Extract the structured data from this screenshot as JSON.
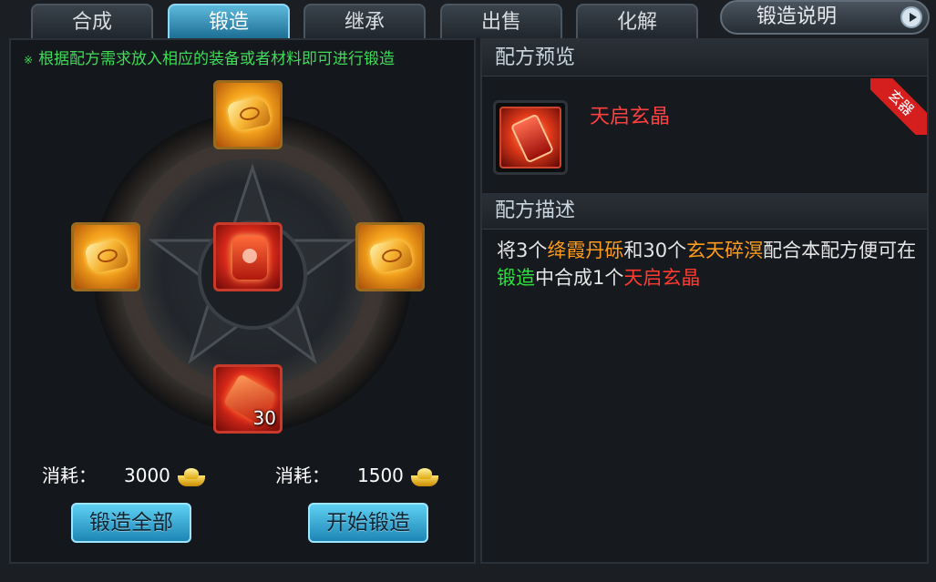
{
  "tabs": [
    {
      "label": "合成",
      "active": false
    },
    {
      "label": "锻造",
      "active": true
    },
    {
      "label": "继承",
      "active": false
    },
    {
      "label": "出售",
      "active": false
    },
    {
      "label": "化解",
      "active": false
    }
  ],
  "help_button": {
    "label": "锻造说明"
  },
  "forge": {
    "hint": "根据配方需求放入相应的装备或者材料即可进行锻造",
    "hint_mark": "※",
    "bottom_item_count": "30",
    "cost_all": {
      "label": "消耗：",
      "value": "3000"
    },
    "cost_single": {
      "label": "消耗：",
      "value": "1500"
    },
    "forge_all_button": "锻造全部",
    "start_forge_button": "开始锻造"
  },
  "preview": {
    "title": "配方预览",
    "item_name": "天启玄晶",
    "badge": "玄器"
  },
  "description": {
    "title": "配方描述",
    "parts": [
      {
        "text": "将3个",
        "color": "white"
      },
      {
        "text": "绛霞丹砾",
        "color": "orange"
      },
      {
        "text": "和30个",
        "color": "white"
      },
      {
        "text": "玄天碎溟",
        "color": "orange"
      },
      {
        "text": "配合本配方便可在",
        "color": "white"
      },
      {
        "text": "锻造",
        "color": "green"
      },
      {
        "text": "中合成1个",
        "color": "white"
      },
      {
        "text": "天启玄晶",
        "color": "red"
      }
    ]
  },
  "colors": {
    "accent": "#5db9dc",
    "hint_green": "#3fdc5a",
    "item_red": "#ff4040"
  }
}
